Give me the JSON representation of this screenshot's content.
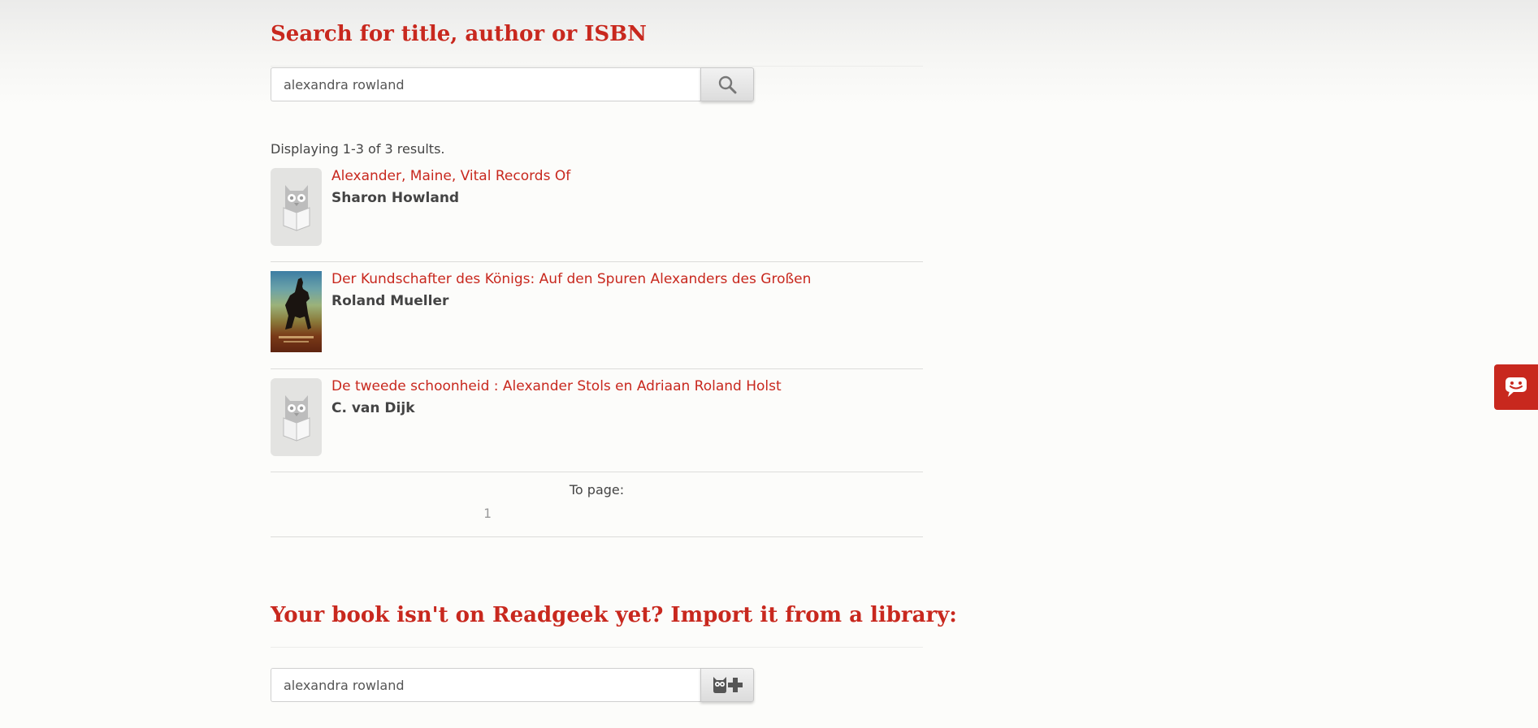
{
  "search": {
    "title": "Search for title, author or ISBN",
    "query": "alexandra rowland",
    "button_icon": "magnifier-icon"
  },
  "results": {
    "count_text": "Displaying 1-3 of 3 results.",
    "items": [
      {
        "title": "Alexander, Maine, Vital Records Of",
        "author": "Sharon Howland",
        "cover": "owl-placeholder-icon"
      },
      {
        "title": "Der Kundschafter des Königs: Auf den Spuren Alexanders des Großen",
        "author": "Roland Mueller",
        "cover": "book-cover-image"
      },
      {
        "title": "De tweede schoonheid : Alexander Stols en Adriaan Roland Holst",
        "author": "C. van Dijk",
        "cover": "owl-placeholder-icon"
      }
    ]
  },
  "pager": {
    "label": "To page:",
    "pages": [
      "1"
    ]
  },
  "import": {
    "title": "Your book isn't on Readgeek yet? Import it from a library:",
    "query": "alexandra rowland",
    "button_icon": "owl-add-icon"
  },
  "feedback": {
    "icon": "chat-smiley-icon"
  },
  "colors": {
    "accent": "#c8281e",
    "text": "#444444",
    "background": "#fcfcfa"
  }
}
